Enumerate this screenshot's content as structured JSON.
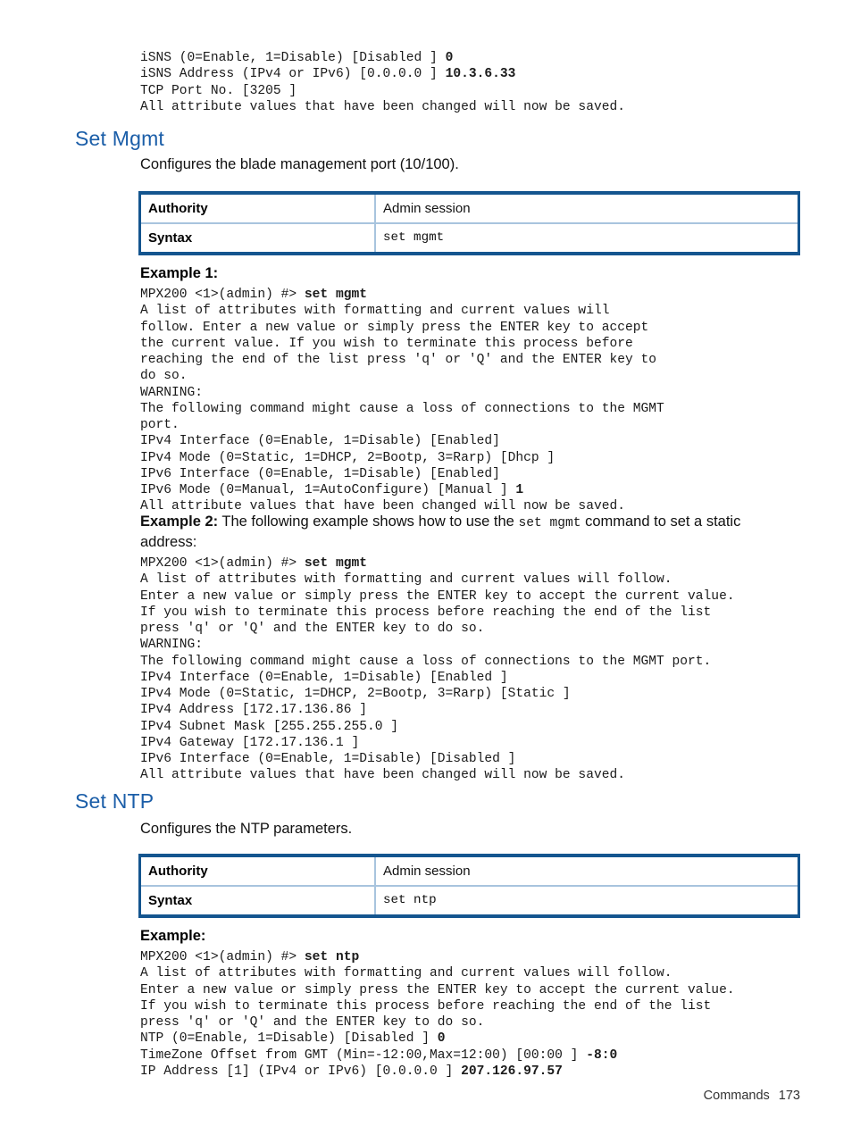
{
  "document": {
    "footer": {
      "chapter": "Commands",
      "page_number": "173"
    }
  },
  "top_console": {
    "lines": "iSNS (0=Enable, 1=Disable) [Disabled ] 0\niSNS Address (IPv4 or IPv6) [0.0.0.0 ] 10.3.6.33\nTCP Port No. [3205 ]\nAll attribute values that have been changed will now be saved.",
    "bold_values": [
      "0",
      "10.3.6.33"
    ]
  },
  "sections": [
    {
      "id": "set-mgmt",
      "heading": "Set Mgmt",
      "description": "Configures the blade management port (10/100).",
      "table": {
        "rows": [
          {
            "label": "Authority",
            "value": "Admin session",
            "mono": false
          },
          {
            "label": "Syntax",
            "value": "set mgmt",
            "mono": true
          }
        ]
      },
      "examples": [
        {
          "label": "Example 1:",
          "console": "MPX200 <1>(admin) #> set mgmt\nA list of attributes with formatting and current values will\nfollow. Enter a new value or simply press the ENTER key to accept\nthe current value. If you wish to terminate this process before\nreaching the end of the list press 'q' or 'Q' and the ENTER key to\ndo so.\nWARNING:\nThe following command might cause a loss of connections to the MGMT\nport.\nIPv4 Interface (0=Enable, 1=Disable) [Enabled]\nIPv4 Mode (0=Static, 1=DHCP, 2=Bootp, 3=Rarp) [Dhcp ]\nIPv6 Interface (0=Enable, 1=Disable) [Enabled]\nIPv6 Mode (0=Manual, 1=AutoConfigure) [Manual ] 1\nAll attribute values that have been changed will now be saved."
        },
        {
          "label": "Example 2:",
          "intro_before": " The following example shows how to use the ",
          "intro_code": "set  mgmt",
          "intro_after": " command to set a static address:",
          "console": "MPX200 <1>(admin) #> set mgmt\nA list of attributes with formatting and current values will follow.\nEnter a new value or simply press the ENTER key to accept the current value.\nIf you wish to terminate this process before reaching the end of the list\npress 'q' or 'Q' and the ENTER key to do so.\nWARNING:\nThe following command might cause a loss of connections to the MGMT port.\nIPv4 Interface (0=Enable, 1=Disable) [Enabled ]\nIPv4 Mode (0=Static, 1=DHCP, 2=Bootp, 3=Rarp) [Static ]\nIPv4 Address [172.17.136.86 ]\nIPv4 Subnet Mask [255.255.255.0 ]\nIPv4 Gateway [172.17.136.1 ]\nIPv6 Interface (0=Enable, 1=Disable) [Disabled ]\nAll attribute values that have been changed will now be saved."
        }
      ]
    },
    {
      "id": "set-ntp",
      "heading": "Set NTP",
      "description": "Configures the NTP parameters.",
      "table": {
        "rows": [
          {
            "label": "Authority",
            "value": "Admin session",
            "mono": false
          },
          {
            "label": "Syntax",
            "value": "set ntp",
            "mono": true
          }
        ]
      },
      "examples": [
        {
          "label": "Example:",
          "console": "MPX200 <1>(admin) #> set ntp\nA list of attributes with formatting and current values will follow.\nEnter a new value or simply press the ENTER key to accept the current value.\nIf you wish to terminate this process before reaching the end of the list\npress 'q' or 'Q' and the ENTER key to do so.\nNTP (0=Enable, 1=Disable) [Disabled ] 0\nTimeZone Offset from GMT (Min=-12:00,Max=12:00) [00:00 ] -8:0\nIP Address [1] (IPv4 or IPv6) [0.0.0.0 ] 207.126.97.57"
        }
      ]
    }
  ],
  "colors": {
    "heading_blue": "#1b5ea8",
    "table_border_dark": "#14558f",
    "table_border_light": "#a8c4de"
  }
}
